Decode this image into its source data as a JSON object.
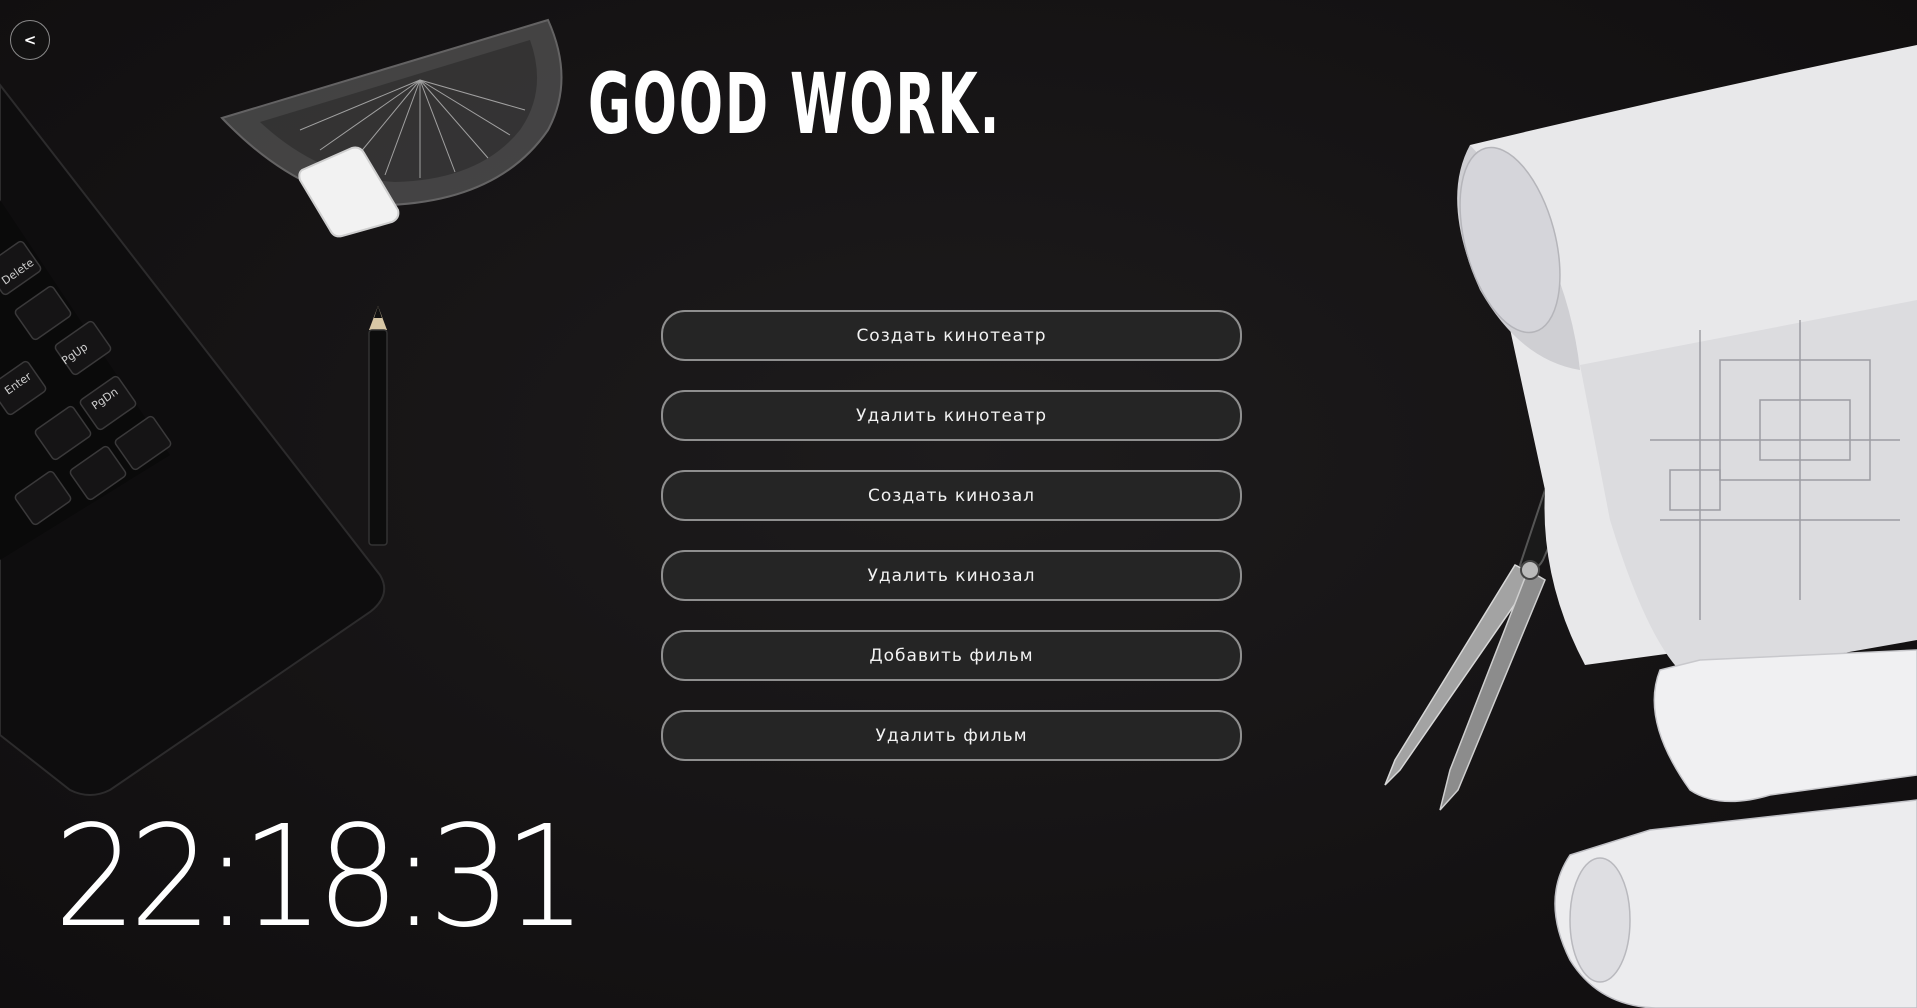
{
  "app": {
    "title": "GOOD WORK."
  },
  "back_button": {
    "glyph": "<",
    "icon": "back-arrow-icon"
  },
  "menu": {
    "items": [
      {
        "label": "Создать кинотеатр"
      },
      {
        "label": "Удалить кинотеатр"
      },
      {
        "label": "Создать кинозал"
      },
      {
        "label": "Удалить кинозал"
      },
      {
        "label": "Добавить фильм"
      },
      {
        "label": "Удалить фильм"
      }
    ]
  },
  "clock": {
    "time": "22:18:31"
  },
  "colors": {
    "background": "#161415",
    "button_fill": "#252525",
    "button_border": "#8f8f8f",
    "text": "#ffffff"
  },
  "background_items": [
    "laptop-keyboard-image",
    "protractor-image",
    "eraser-image",
    "pencil-image",
    "compass-image",
    "blueprint-rolls-image"
  ]
}
